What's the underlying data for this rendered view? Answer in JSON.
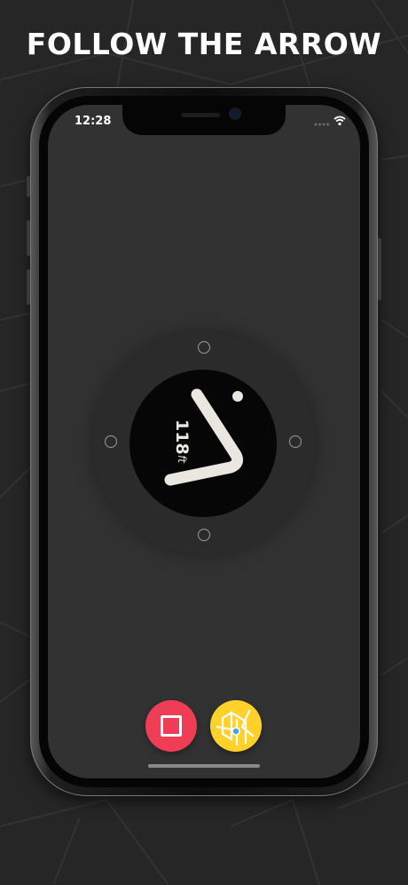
{
  "headline": "FOLLOW THE ARROW",
  "status_bar": {
    "time": "12:28",
    "signal_icon": "cellular-signal-icon",
    "wifi_icon": "wifi-icon"
  },
  "compass": {
    "distance_value": "118",
    "distance_unit": "ft",
    "arrow_icon": "direction-arrow-icon",
    "cardinal_markers": [
      "north",
      "east",
      "south",
      "west"
    ]
  },
  "controls": {
    "stop_icon": "stop-icon",
    "map_icon": "map-icon"
  },
  "colors": {
    "background": "#262626",
    "screen": "#323232",
    "dial": "#060606",
    "arrow": "#e9e7df",
    "stop": "#ef3d56",
    "map": "#ffd22a"
  }
}
